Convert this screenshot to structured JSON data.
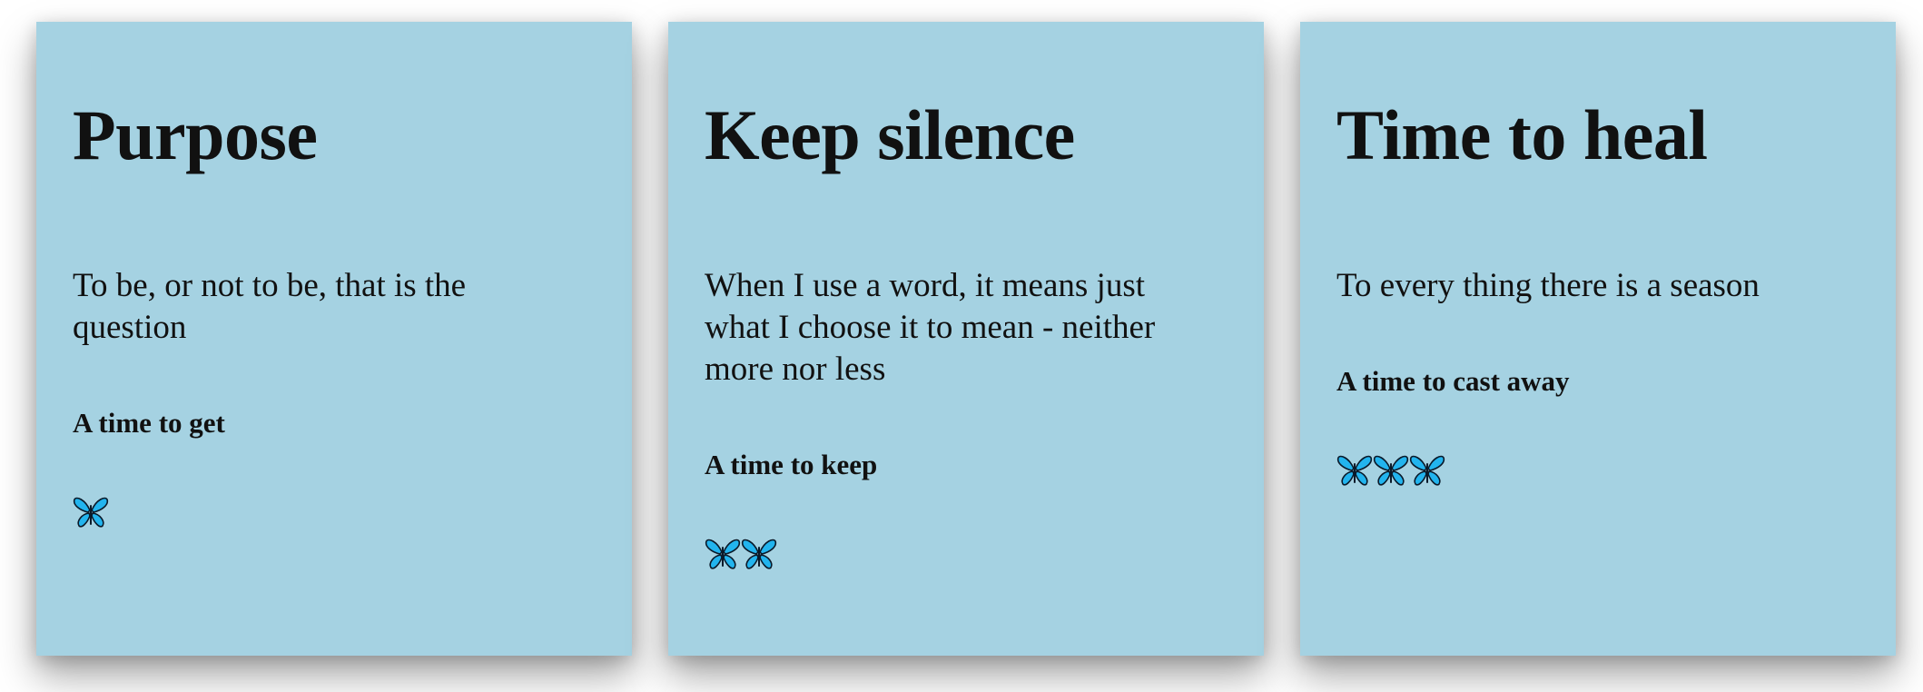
{
  "cards": [
    {
      "title": "Purpose",
      "quote": "To be, or not to be, that is the question",
      "subtitle": "A time to get",
      "butterfly_icon": "butterfly-icon",
      "butterfly_count": 1
    },
    {
      "title": "Keep silence",
      "quote": "When I use a word, it means just what I choose it to mean - neither more nor less",
      "subtitle": "A time to keep",
      "butterfly_icon": "butterfly-icon",
      "butterfly_count": 2
    },
    {
      "title": "Time to heal",
      "quote": "To every thing there is a season",
      "subtitle": "A time to cast away",
      "butterfly_icon": "butterfly-icon",
      "butterfly_count": 3
    }
  ],
  "colors": {
    "card_background": "#a5d2e2",
    "butterfly_fill": "#22b4ee",
    "butterfly_outline": "#0a1a2a"
  }
}
